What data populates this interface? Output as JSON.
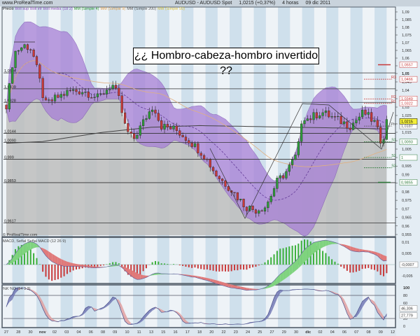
{
  "header": {
    "site": "www.ProRealTime.com",
    "title": "AUDUSD - AUDUSD Spot",
    "price": "1,0215 (+0,37%)",
    "timeframe": "4 horas",
    "date": "09 dic 2011"
  },
  "legend": [
    {
      "text": "Precio",
      "color": "#111111"
    },
    {
      "text": "Boll sup",
      "color": "#8a4fb8"
    },
    {
      "text": "Boll inf",
      "color": "#8a4fb8"
    },
    {
      "text": "Boll media",
      "color": "#8a4fb8"
    },
    {
      "text": "(18 2)",
      "color": "#8a4fb8"
    },
    {
      "text": "MM (Simple 4)",
      "color": "#2f9a2f"
    },
    {
      "text": "MM (Simple 9)",
      "color": "#e0a050"
    },
    {
      "text": "MM (Simple 200)",
      "color": "#555555"
    },
    {
      "text": "MM (Simple 50)",
      "color": "#d8c040"
    }
  ],
  "annotation": "¿¿ Hombro-cabeza-hombro invertido ??",
  "watermark": "© ProRealTime.com",
  "macd_label": "MACD, Señal Señal MACD (12 26 9)",
  "stoch_label": "%K %D (14 3 3)",
  "colors": {
    "up": "#2e9e3a",
    "down": "#c83a3a",
    "band": "#a77fd6",
    "area": "#bdbdbd",
    "macd_up": "#7fd37f",
    "macd_down": "#e07a7a",
    "stoch_k": "#4a4f8a",
    "stoch_d": "#e09a9a"
  },
  "chart_data": {
    "type": "candlestick",
    "title": "AUDUSD - AUDUSD Spot",
    "x_tick_labels": [
      "27",
      "28",
      "30",
      "nov",
      "02",
      "03",
      "04",
      "06",
      "08",
      "09",
      "10",
      "11",
      "13",
      "15",
      "16",
      "17",
      "18",
      "20",
      "22",
      "23",
      "24",
      "25",
      "27",
      "29",
      "30",
      "dic",
      "02",
      "04",
      "06",
      "07",
      "08",
      "09",
      "12"
    ],
    "y_tick_labels": [
      "1,09",
      "1,085",
      "1,08",
      "1,075",
      "1,07",
      "1,065",
      "1,06",
      "1,055",
      "1,05",
      "1,045",
      "1,04",
      "1,035",
      "1,03",
      "1,025",
      "1,02",
      "1,015",
      "1,01",
      "1,005",
      "1",
      "0,995",
      "0,99",
      "0,985",
      "0,98",
      "0,975",
      "0,97",
      "0,965",
      "0,96",
      "0,955"
    ],
    "ylim": [
      0.955,
      1.09
    ],
    "close_path": [
      [
        0.06,
        1.0313
      ],
      [
        0.64,
        1.0636
      ],
      [
        1.5,
        1.0682
      ],
      [
        2.1,
        1.0659
      ],
      [
        2.7,
        1.0479
      ],
      [
        3.2,
        1.0313
      ],
      [
        4.1,
        1.0354
      ],
      [
        5.3,
        1.0396
      ],
      [
        6.4,
        1.0396
      ],
      [
        7.6,
        1.0354
      ],
      [
        8.75,
        1.0438
      ],
      [
        9.3,
        1.0354
      ],
      [
        9.9,
        1.0167
      ],
      [
        10.5,
        1.0104
      ],
      [
        11.65,
        1.025
      ],
      [
        12.2,
        1.0313
      ],
      [
        12.8,
        1.0188
      ],
      [
        14,
        1.0167
      ],
      [
        15.1,
        1.0104
      ],
      [
        16.3,
        1.0021
      ],
      [
        17.4,
        0.9898
      ],
      [
        18.6,
        0.9816
      ],
      [
        19.8,
        0.9714
      ],
      [
        20.6,
        0.9693
      ],
      [
        21.5,
        0.9714
      ],
      [
        22.4,
        0.9857
      ],
      [
        23.2,
        0.9918
      ],
      [
        24.1,
        1.0021
      ],
      [
        24.5,
        1.025
      ],
      [
        25,
        1.0229
      ],
      [
        26.1,
        1.0271
      ],
      [
        27.3,
        1.0229
      ],
      [
        28.5,
        1.0188
      ],
      [
        29.6,
        1.0271
      ],
      [
        30.5,
        1.0208
      ],
      [
        31.1,
        1.0083
      ],
      [
        31.5,
        1.0215
      ]
    ],
    "ma200_path": [
      [
        0,
        1.0085
      ],
      [
        3,
        1.0095
      ],
      [
        8,
        1.015
      ],
      [
        12,
        1.018
      ],
      [
        16,
        1.019
      ],
      [
        20,
        1.0185
      ],
      [
        24,
        1.018
      ],
      [
        28,
        1.0175
      ],
      [
        31.5,
        1.017
      ]
    ],
    "horizontal_levels": [
      {
        "label": "1,0504",
        "value": 1.0504
      },
      {
        "label": "1,0409",
        "value": 1.0409
      },
      {
        "label": "1,0328",
        "value": 1.0328
      },
      {
        "label": "1,0144",
        "value": 1.0144
      },
      {
        "label": "1,0090",
        "value": 1.009
      },
      {
        "label": "0,999",
        "value": 0.999
      },
      {
        "label": "0,9853",
        "value": 0.9853
      },
      {
        "label": "0,9617",
        "value": 0.9617
      }
    ],
    "pivots": [
      {
        "name": "R3",
        "value": 1.0466,
        "tag": "1,0466",
        "color": "#c83a3a"
      },
      {
        "name": "R2",
        "value": 1.0349,
        "tag": "1,0349",
        "color": "#c83a3a"
      },
      {
        "name": "R1",
        "value": 1.0322,
        "tag": "1,0322",
        "color": "#c83a3a"
      },
      {
        "name": "Piv",
        "value": 1.0187,
        "tag": "1,0187",
        "color": "#555555"
      },
      {
        "name": "S1",
        "value": 1.0093,
        "tag": "1,0093",
        "color": "#2e7a3a"
      },
      {
        "name": "S2",
        "value": 1.0,
        "tag": "1",
        "color": "#2e7a3a"
      },
      {
        "name": "S3",
        "value": 0.994,
        "tag": "",
        "color": "#2e7a3a"
      }
    ],
    "extra_tags": [
      {
        "tag": "1,0557",
        "value": 1.0557,
        "color": "#c83a3a"
      },
      {
        "tag": "0,9855",
        "value": 0.9855,
        "color": "#2e7a3a"
      }
    ],
    "last_price": {
      "tag": "1,0215",
      "value": 1.0215
    },
    "macd": {
      "ticks": [
        "0,01",
        "0,005",
        "-0,005"
      ],
      "last": "-0,0007"
    },
    "stoch": {
      "ticks": [
        "100",
        "80",
        "60",
        "20",
        "0"
      ],
      "last_k": "46,306",
      "last_d": "27,779"
    }
  }
}
